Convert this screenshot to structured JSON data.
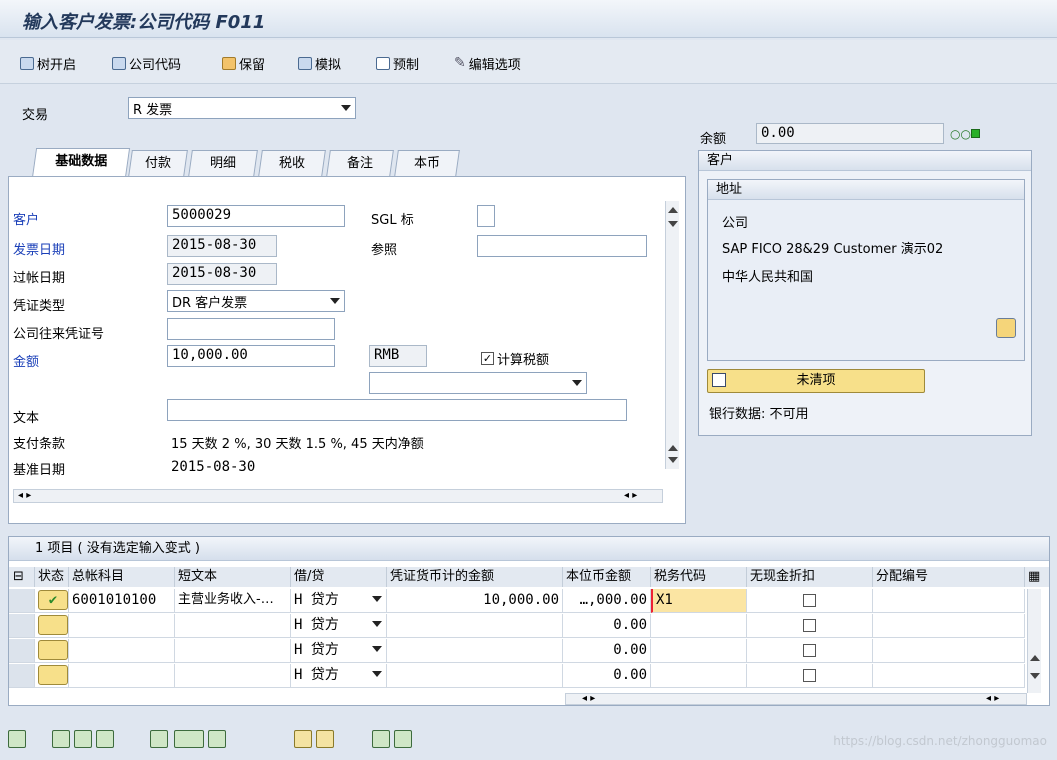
{
  "title": "输入客户发票:公司代码 F011",
  "toolbar": [
    "树开启",
    "公司代码",
    "保留",
    "模拟",
    "预制",
    "编辑选项"
  ],
  "transaction": {
    "label": "交易",
    "value": "R 发票"
  },
  "balance": {
    "label": "余额",
    "value": "0.00"
  },
  "tabs": [
    "基础数据",
    "付款",
    "明细",
    "税收",
    "备注",
    "本币"
  ],
  "form": {
    "customer_label": "客户",
    "customer_value": "5000029",
    "sgl_label": "SGL 标",
    "invoice_date_label": "发票日期",
    "invoice_date_value": "2015-08-30",
    "reference_label": "参照",
    "posting_date_label": "过帐日期",
    "posting_date_value": "2015-08-30",
    "doc_type_label": "凭证类型",
    "doc_type_value": "DR 客户发票",
    "cross_cc_label": "公司往来凭证号",
    "amount_label": "金额",
    "amount_value": "10,000.00",
    "currency": "RMB",
    "calc_tax_label": "计算税额",
    "text_label": "文本",
    "payment_terms_label": "支付条款",
    "payment_terms_value": "15 天数 2 %, 30 天数 1.5 %, 45 天内净额",
    "baseline_label": "基准日期",
    "baseline_value": "2015-08-30"
  },
  "customer_box": {
    "title": "客户",
    "address_title": "地址",
    "lines": [
      "公司",
      "SAP FICO 28&29 Customer 演示02",
      "中华人民共和国"
    ],
    "open_items_button": "未清项",
    "bank_data": "银行数据: 不可用"
  },
  "table": {
    "caption": "1 项目 ( 没有选定输入变式 )",
    "headers": [
      "状态",
      "总帐科目",
      "短文本",
      "借/贷",
      "凭证货币计的金额",
      "本位币金额",
      "税务代码",
      "无现金折扣",
      "分配编号"
    ],
    "rows": [
      {
        "gl": "6001010100",
        "text": "主营业务收入-…",
        "dc": "H 贷方",
        "amount": "10,000.00",
        "local": "…,000.00",
        "tax": "X1"
      },
      {
        "gl": "",
        "text": "",
        "dc": "H 贷方",
        "amount": "",
        "local": "0.00",
        "tax": ""
      },
      {
        "gl": "",
        "text": "",
        "dc": "H 贷方",
        "amount": "",
        "local": "0.00",
        "tax": ""
      },
      {
        "gl": "",
        "text": "",
        "dc": "H 贷方",
        "amount": "",
        "local": "0.00",
        "tax": ""
      }
    ]
  },
  "watermark": "https://blog.csdn.net/zhongguomao",
  "colors": {
    "accent": "#f7e08a",
    "label_blue": "#1a3fb8"
  }
}
